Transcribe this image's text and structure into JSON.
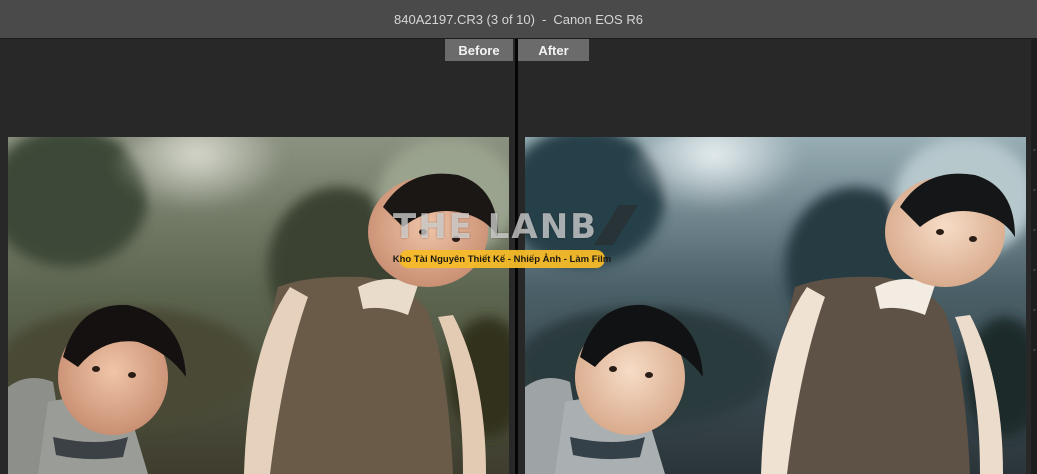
{
  "window": {
    "filename": "840A2197.CR3 (3 of 10)",
    "separator": "-",
    "camera": "Canon EOS R6"
  },
  "compare": {
    "before_label": "Before",
    "after_label": "After"
  },
  "watermark": {
    "logo_text": "THE LANB",
    "tagline": "Kho Tài Nguyên Thiết Kế - Nhiếp Ảnh - Làm Film",
    "logo_color": "#e0e0e0",
    "tag_color": "#f5ba28"
  },
  "colors": {
    "title_bar": "#4a4a4a",
    "background": "#282828",
    "label_button": "#6b6b6b",
    "divider": "#050505"
  }
}
